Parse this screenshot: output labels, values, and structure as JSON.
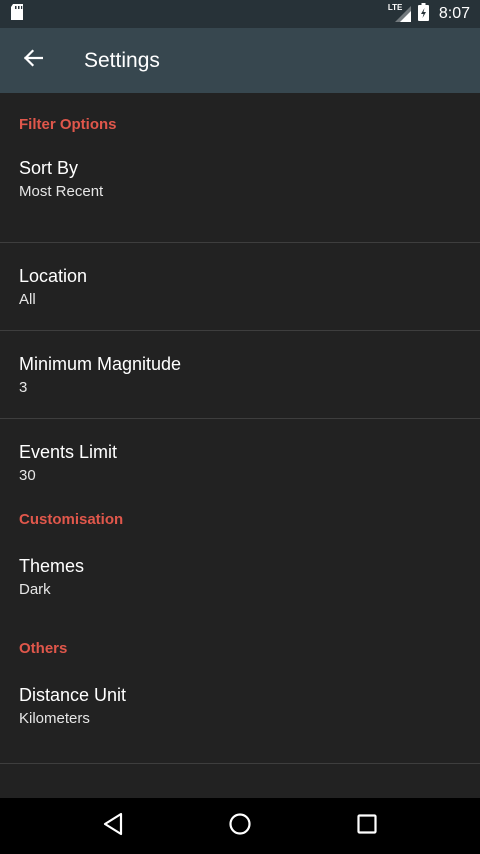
{
  "status_bar": {
    "time": "8:07",
    "network_label": "LTE",
    "icons": [
      "sd-card-icon",
      "lte-signal-icon",
      "battery-icon"
    ]
  },
  "app_bar": {
    "title": "Settings",
    "back_icon": "arrow-back-icon"
  },
  "sections": {
    "filter": {
      "header": "Filter Options",
      "sort_by": {
        "title": "Sort By",
        "summary": "Most Recent"
      },
      "location": {
        "title": "Location",
        "summary": "All"
      },
      "min_magnitude": {
        "title": "Minimum Magnitude",
        "summary": "3"
      },
      "events_limit": {
        "title": "Events Limit",
        "summary": "30"
      }
    },
    "customisation": {
      "header": "Customisation",
      "themes": {
        "title": "Themes",
        "summary": "Dark"
      }
    },
    "others": {
      "header": "Others",
      "distance_unit": {
        "title": "Distance Unit",
        "summary": "Kilometers"
      }
    }
  },
  "nav_bar": {
    "icons": [
      "back-triangle-icon",
      "home-circle-icon",
      "recents-square-icon"
    ]
  },
  "colors": {
    "status_bar": "#273238",
    "app_bar": "#37474f",
    "background": "#222222",
    "accent": "#e0574b",
    "nav_bar": "#000000"
  }
}
